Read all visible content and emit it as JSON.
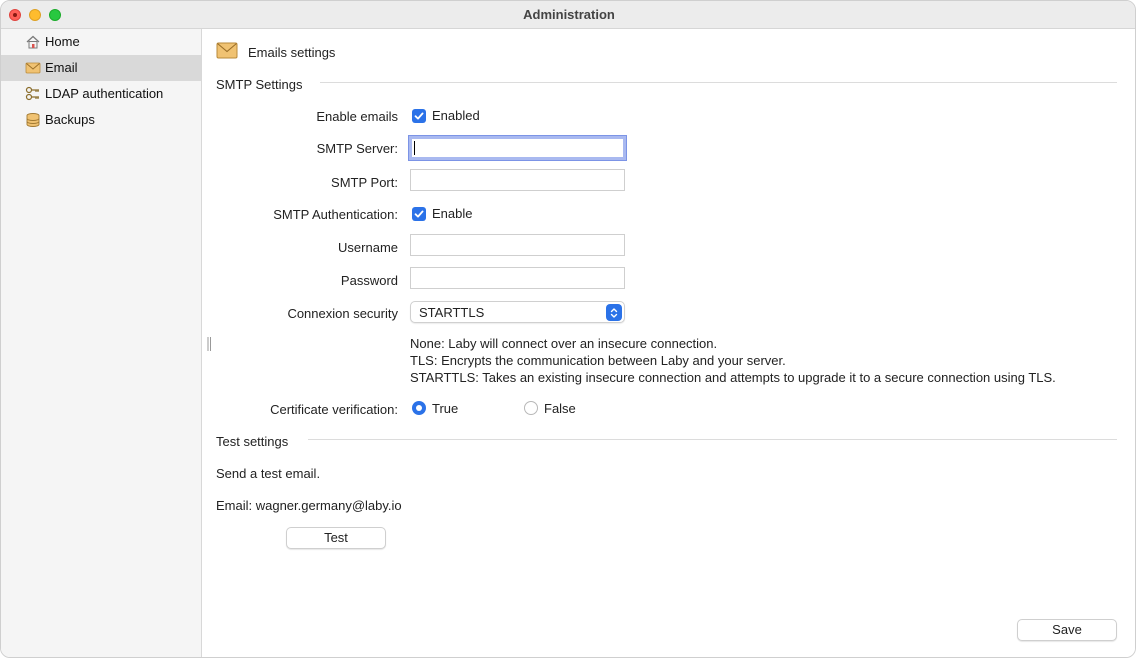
{
  "window": {
    "title": "Administration"
  },
  "sidebar": {
    "items": [
      {
        "label": "Home",
        "icon": "home-icon",
        "selected": false
      },
      {
        "label": "Email",
        "icon": "envelope-icon",
        "selected": true
      },
      {
        "label": "LDAP authentication",
        "icon": "ldap-keys-icon",
        "selected": false
      },
      {
        "label": "Backups",
        "icon": "database-icon",
        "selected": false
      }
    ]
  },
  "header": {
    "title": "Emails settings",
    "icon": "envelope-icon"
  },
  "smtp": {
    "section_title": "SMTP Settings",
    "enable_emails": {
      "label": "Enable emails",
      "checkbox_label": "Enabled",
      "checked": true
    },
    "server": {
      "label": "SMTP Server:",
      "value": ""
    },
    "port": {
      "label": "SMTP Port:",
      "value": ""
    },
    "auth": {
      "label": "SMTP Authentication:",
      "checkbox_label": "Enable",
      "checked": true
    },
    "username": {
      "label": "Username",
      "value": ""
    },
    "password": {
      "label": "Password",
      "value": ""
    },
    "security": {
      "label": "Connexion security",
      "value": "STARTTLS"
    },
    "help": [
      "None: Laby will connect over an insecure connection.",
      "TLS: Encrypts the communication between Laby and your server.",
      "STARTTLS: Takes an existing insecure connection and attempts to upgrade it to a secure connection using TLS."
    ],
    "cert": {
      "label": "Certificate verification:",
      "true_label": "True",
      "false_label": "False",
      "selected": "True"
    }
  },
  "test": {
    "section_title": "Test settings",
    "description": "Send a test email.",
    "email_line": "Email: wagner.germany@laby.io",
    "button_label": "Test"
  },
  "footer": {
    "save_label": "Save"
  },
  "colors": {
    "accent": "#2b72e8",
    "sidebar_selected": "#d9d9d9",
    "envelope": "#e8b45a"
  }
}
